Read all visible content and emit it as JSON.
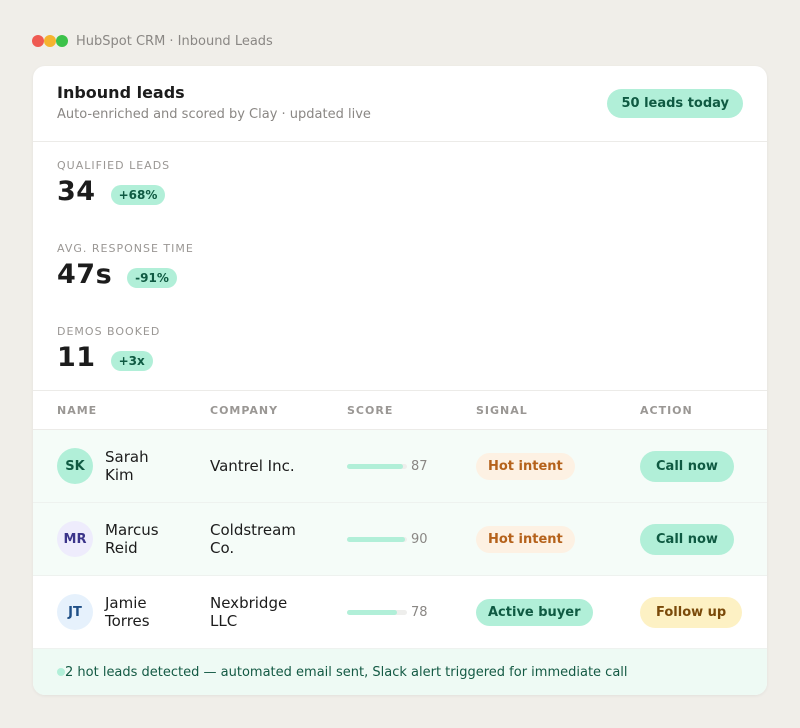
{
  "window": {
    "title": "HubSpot CRM · Inbound Leads",
    "controls": [
      "close-icon",
      "minimize-icon",
      "maximize-icon"
    ]
  },
  "header": {
    "title": "Inbound leads",
    "subtitle": "Auto-enriched and scored by Clay · updated live",
    "badge": "50 leads today"
  },
  "stats": [
    {
      "label": "Qualified leads",
      "value": "34",
      "delta": "+68%"
    },
    {
      "label": "Avg. response time",
      "value": "47s",
      "delta": "-91%"
    },
    {
      "label": "Demos booked",
      "value": "11",
      "delta": "+3x"
    }
  ],
  "table": {
    "columns": [
      "NAME",
      "COMPANY",
      "SCORE",
      "SIGNAL",
      "ACTION"
    ],
    "rows": [
      {
        "initials": "SK",
        "name": "Sarah Kim",
        "company": "Vantrel Inc.",
        "score": "87",
        "score_pct": 87,
        "signal": "Hot intent",
        "action": "Call now"
      },
      {
        "initials": "MR",
        "name": "Marcus Reid",
        "company": "Coldstream Co.",
        "score": "90",
        "score_pct": 90,
        "signal": "Hot intent",
        "action": "Call now"
      },
      {
        "initials": "JT",
        "name": "Jamie Torres",
        "company": "Nexbridge LLC",
        "score": "78",
        "score_pct": 78,
        "signal": "Active buyer",
        "action": "Follow up"
      }
    ]
  },
  "footer": {
    "message": "2 hot leads detected — automated email sent, Slack alert triggered for immediate call"
  },
  "colors": {
    "accent_mint": "#b1efd8",
    "hot_signal_bg": "#fdf1e3",
    "hot_signal_text": "#b5621b",
    "follow_up_bg": "#fdf1c4",
    "follow_up_text": "#7a4a0a",
    "avatar_sk_bg": "#b1efd8",
    "avatar_mr_bg": "#eeecfc",
    "avatar_jt_bg": "#e6f1fc"
  }
}
